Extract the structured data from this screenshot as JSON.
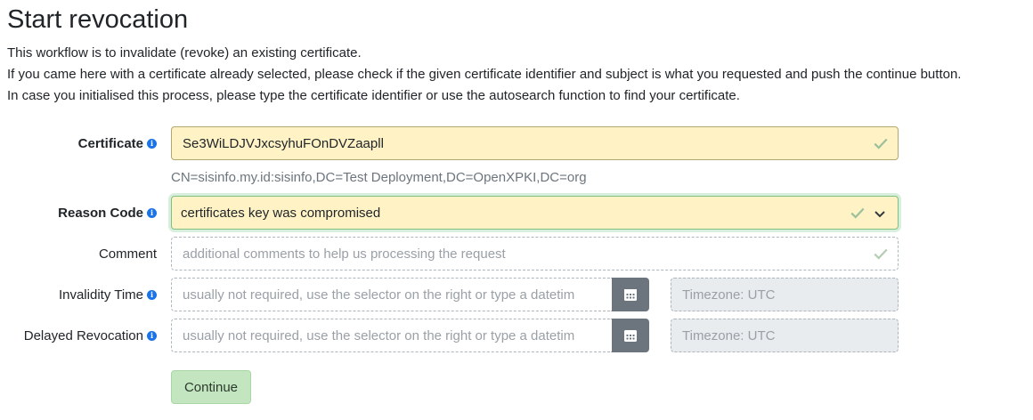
{
  "page": {
    "title": "Start revocation",
    "intro": [
      "This workflow is to invalidate (revoke) an existing certificate.",
      "If you came here with a certificate already selected, please check if the given certificate identifier and subject is what you requested and push the continue button.",
      "In case you initialised this process, please type the certificate identifier or use the autosearch function to find your certificate."
    ]
  },
  "form": {
    "certificate": {
      "label": "Certificate",
      "value": "Se3WiLDJVJxcsyhuFOnDVZaapll",
      "subject": "CN=sisinfo.my.id:sisinfo,DC=Test Deployment,DC=OpenXPKI,DC=org"
    },
    "reason_code": {
      "label": "Reason Code",
      "value": "certificates key was compromised"
    },
    "comment": {
      "label": "Comment",
      "placeholder": "additional comments to help us processing the request"
    },
    "invalidity_time": {
      "label": "Invalidity Time",
      "placeholder": "usually not required, use the selector on the right or type a datetim",
      "timezone": "Timezone: UTC"
    },
    "delayed_revocation": {
      "label": "Delayed Revocation",
      "placeholder": "usually not required, use the selector on the right or type a datetim",
      "timezone": "Timezone: UTC"
    },
    "continue_label": "Continue"
  },
  "icons": {
    "info": "info-circle-icon",
    "valid": "check-icon",
    "dropdown": "chevron-down-icon",
    "calendar": "calendar-icon"
  },
  "colors": {
    "filled_field": "#fff3c6",
    "info_icon": "#1a73e8",
    "continue_button": "#c3e6c0",
    "calendar_button": "#6c757d"
  }
}
